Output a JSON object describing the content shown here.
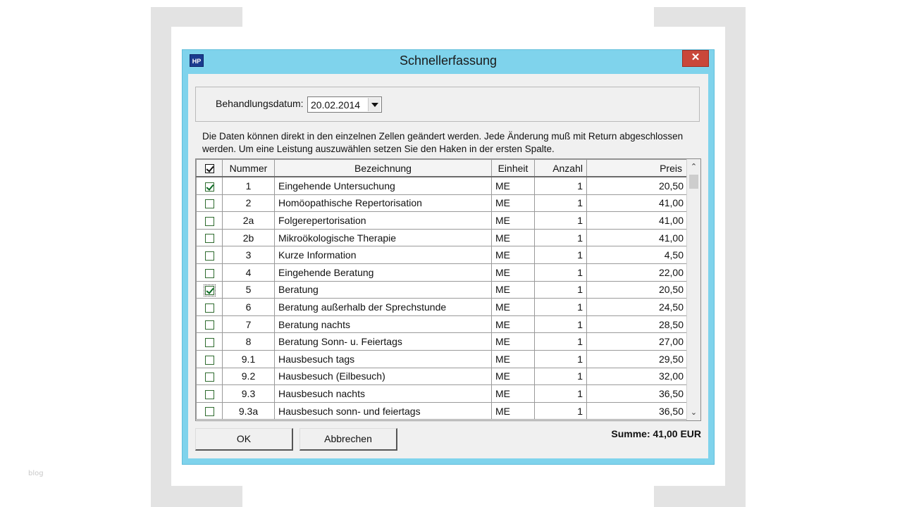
{
  "watermark": "blog",
  "dialog": {
    "title": "Schnellerfassung",
    "icon_label": "HP",
    "close_symbol": "✕"
  },
  "date": {
    "label": "Behandlungsdatum:",
    "value": "20.02.2014"
  },
  "info_text": "Die Daten können direkt in den einzelnen Zellen geändert werden. Jede Änderung muß mit Return abgeschlossen werden. Um eine Leistung auszuwählen setzen Sie den Haken in der ersten Spalte.",
  "table": {
    "header_checked": true,
    "columns": [
      "Nummer",
      "Bezeichnung",
      "Einheit",
      "Anzahl",
      "Preis"
    ],
    "rows": [
      {
        "checked": true,
        "nummer": "1",
        "bezeichnung": "Eingehende Untersuchung",
        "einheit": "ME",
        "anzahl": "1",
        "preis": "20,50"
      },
      {
        "checked": false,
        "nummer": "2",
        "bezeichnung": "Homöopathische Repertorisation",
        "einheit": "ME",
        "anzahl": "1",
        "preis": "41,00"
      },
      {
        "checked": false,
        "nummer": "2a",
        "bezeichnung": "Folgerepertorisation",
        "einheit": "ME",
        "anzahl": "1",
        "preis": "41,00"
      },
      {
        "checked": false,
        "nummer": "2b",
        "bezeichnung": "Mikroökologische Therapie",
        "einheit": "ME",
        "anzahl": "1",
        "preis": "41,00"
      },
      {
        "checked": false,
        "nummer": "3",
        "bezeichnung": "Kurze Information",
        "einheit": "ME",
        "anzahl": "1",
        "preis": "4,50"
      },
      {
        "checked": false,
        "nummer": "4",
        "bezeichnung": "Eingehende Beratung",
        "einheit": "ME",
        "anzahl": "1",
        "preis": "22,00"
      },
      {
        "checked": true,
        "nummer": "5",
        "bezeichnung": "Beratung",
        "einheit": "ME",
        "anzahl": "1",
        "preis": "20,50",
        "focused": true
      },
      {
        "checked": false,
        "nummer": "6",
        "bezeichnung": "Beratung außerhalb der Sprechstunde",
        "einheit": "ME",
        "anzahl": "1",
        "preis": "24,50"
      },
      {
        "checked": false,
        "nummer": "7",
        "bezeichnung": "Beratung nachts",
        "einheit": "ME",
        "anzahl": "1",
        "preis": "28,50"
      },
      {
        "checked": false,
        "nummer": "8",
        "bezeichnung": "Beratung Sonn- u. Feiertags",
        "einheit": "ME",
        "anzahl": "1",
        "preis": "27,00"
      },
      {
        "checked": false,
        "nummer": "9.1",
        "bezeichnung": "Hausbesuch tags",
        "einheit": "ME",
        "anzahl": "1",
        "preis": "29,50"
      },
      {
        "checked": false,
        "nummer": "9.2",
        "bezeichnung": "Hausbesuch (Eilbesuch)",
        "einheit": "ME",
        "anzahl": "1",
        "preis": "32,00"
      },
      {
        "checked": false,
        "nummer": "9.3",
        "bezeichnung": "Hausbesuch nachts",
        "einheit": "ME",
        "anzahl": "1",
        "preis": "36,50"
      },
      {
        "checked": false,
        "nummer": "9.3a",
        "bezeichnung": "Hausbesuch sonn- und feiertags",
        "einheit": "ME",
        "anzahl": "1",
        "preis": "36,50"
      }
    ]
  },
  "buttons": {
    "ok": "OK",
    "cancel": "Abbrechen"
  },
  "summe": "Summe: 41,00 EUR",
  "colors": {
    "window_frame": "#7fd3ec",
    "close_button": "#c9473a",
    "checkmark": "#0a6a22"
  }
}
